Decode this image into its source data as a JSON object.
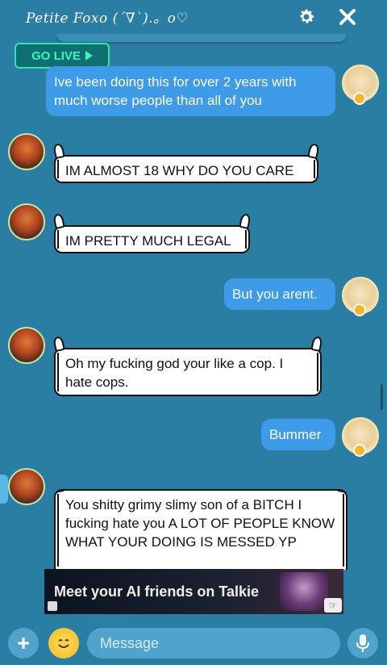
{
  "header": {
    "title": "Petite Foxo (´∇`).。o♡"
  },
  "live": {
    "label": "GO LIVE"
  },
  "messages": [
    {
      "side": "out",
      "text": "Ive been doing this for over 2 years with much worse people than all of you"
    },
    {
      "side": "in",
      "text": "IM ALMOST 18 WHY DO YOU CARE"
    },
    {
      "side": "in",
      "text": "IM PRETTY MUCH LEGAL"
    },
    {
      "side": "out",
      "text": "But you arent."
    },
    {
      "side": "in",
      "text": "Oh my fucking god your like a cop. I hate cops."
    },
    {
      "side": "out",
      "text": "Bummer"
    },
    {
      "side": "in",
      "text": "You shitty grimy slimy son of a BITCH I fucking hate you A LOT OF PEOPLE KNOW WHAT YOUR DOING IS MESSED YP"
    }
  ],
  "ad": {
    "text": "Meet your AI friends on Talkie"
  },
  "composer": {
    "placeholder": "Message"
  },
  "colors": {
    "background": "#2b7ea3",
    "outgoing_bubble": "#3d9be8",
    "incoming_bubble": "#ffffff",
    "go_live_accent": "#3af5c0"
  },
  "icons": [
    "gear-icon",
    "close-icon",
    "play-icon",
    "plus-icon",
    "emoji-icon",
    "microphone-icon",
    "hand-pointer-icon"
  ]
}
